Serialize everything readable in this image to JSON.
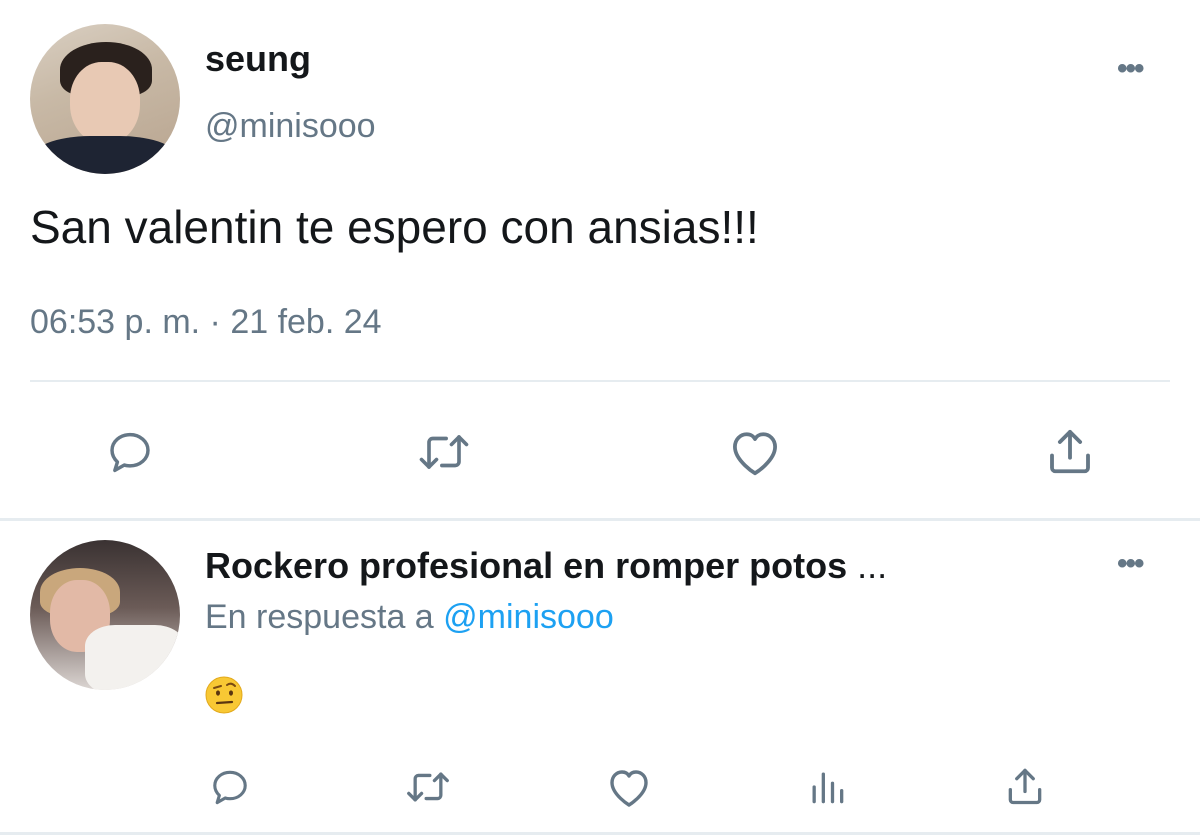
{
  "tweet": {
    "display_name": "seung",
    "handle": "@minisooo",
    "text": "San valentin te espero con ansias!!!",
    "timestamp": "06:53 p. m. · 21 feb. 24",
    "more_label": "•••",
    "actions": [
      "reply-icon",
      "retweet-icon",
      "like-icon",
      "share-icon"
    ]
  },
  "reply": {
    "display_name": "Rockero profesional en romper potos",
    "ellipsis": "...",
    "reply_prefix": "En respuesta a",
    "reply_mention": "@minisooo",
    "emoji": "face-with-raised-eyebrow",
    "more_label": "•••",
    "actions": [
      "reply-icon",
      "retweet-icon",
      "like-icon",
      "analytics-icon",
      "share-icon"
    ]
  },
  "colors": {
    "text": "#14171a",
    "secondary": "#657786",
    "link": "#1da1f2",
    "divider": "#e6ecf0"
  }
}
